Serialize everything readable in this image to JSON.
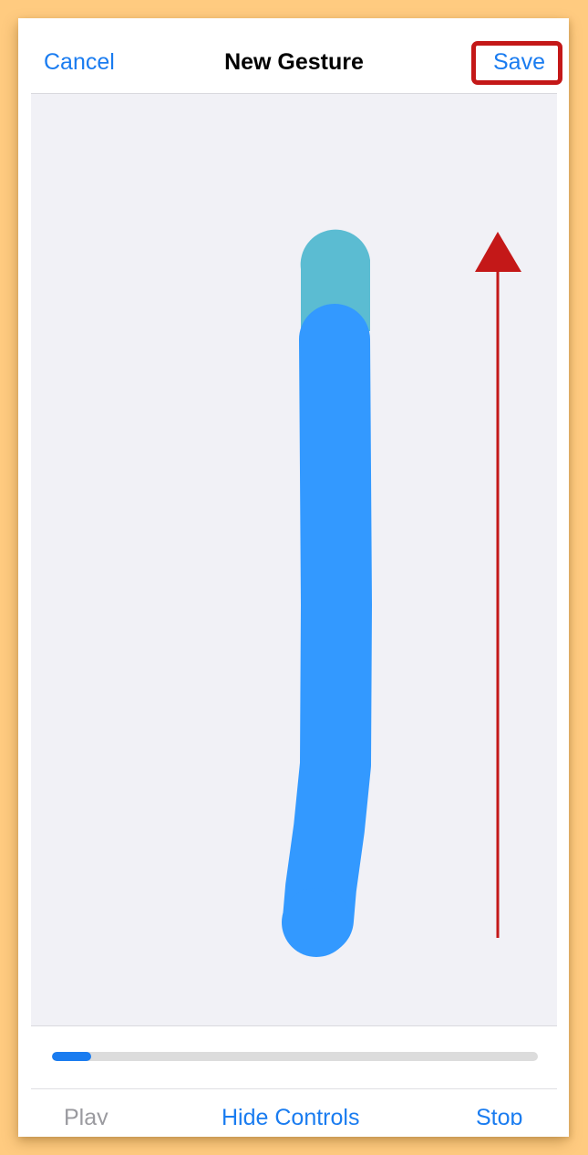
{
  "navbar": {
    "cancel_label": "Cancel",
    "title": "New Gesture",
    "save_label": "Save"
  },
  "playback": {
    "progress": 0.08
  },
  "controls": {
    "play_label": "Play",
    "hide_controls_label": "Hide Controls",
    "stop_label": "Stop"
  },
  "colors": {
    "accent": "#1a7cf0",
    "gesture_stroke": "#3399ff",
    "gesture_start": "#5bbcd2",
    "annotation": "#c41818",
    "background": "#ffcb80"
  }
}
